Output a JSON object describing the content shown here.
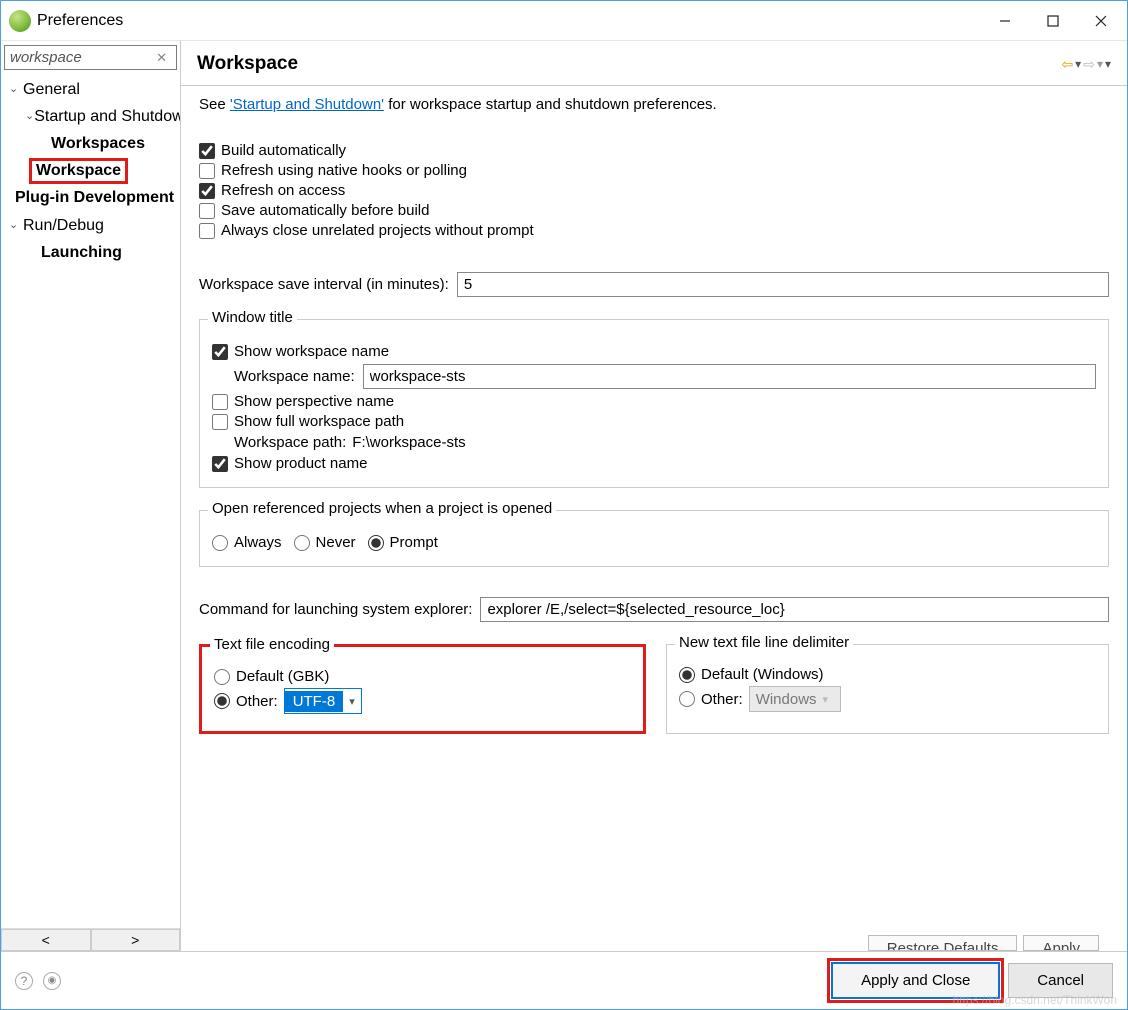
{
  "window": {
    "title": "Preferences"
  },
  "sidebar": {
    "search": {
      "value": "workspace"
    },
    "tree": {
      "general": "General",
      "startup": "Startup and Shutdown",
      "workspaces": "Workspaces",
      "workspace": "Workspace",
      "plugin": "Plug-in Development",
      "rundebug": "Run/Debug",
      "launching": "Launching"
    }
  },
  "header": {
    "title": "Workspace"
  },
  "content": {
    "see_prefix": "See ",
    "see_link": "'Startup and Shutdown'",
    "see_suffix": " for workspace startup and shutdown preferences.",
    "checks": {
      "build_auto": "Build automatically",
      "refresh_hooks": "Refresh using native hooks or polling",
      "refresh_access": "Refresh on access",
      "save_before": "Save automatically before build",
      "close_unrelated": "Always close unrelated projects without prompt"
    },
    "save_interval_label": "Workspace save interval (in minutes):",
    "save_interval_value": "5",
    "window_title_group": {
      "title": "Window title",
      "show_ws_name": "Show workspace name",
      "ws_name_label": "Workspace name:",
      "ws_name_value": "workspace-sts",
      "show_perspective": "Show perspective name",
      "show_full_path": "Show full workspace path",
      "ws_path_label": "Workspace path:",
      "ws_path_value": "F:\\workspace-sts",
      "show_product": "Show product name"
    },
    "open_ref_group": {
      "title": "Open referenced projects when a project is opened",
      "always": "Always",
      "never": "Never",
      "prompt": "Prompt"
    },
    "explorer_label": "Command for launching system explorer:",
    "explorer_value": "explorer /E,/select=${selected_resource_loc}",
    "encoding_group": {
      "title": "Text file encoding",
      "default": "Default (GBK)",
      "other": "Other:",
      "other_value": "UTF-8"
    },
    "delimiter_group": {
      "title": "New text file line delimiter",
      "default": "Default (Windows)",
      "other": "Other:",
      "other_value": "Windows"
    },
    "restore_defaults": "Restore Defaults",
    "apply": "Apply"
  },
  "footer": {
    "apply_close": "Apply and Close",
    "cancel": "Cancel"
  }
}
